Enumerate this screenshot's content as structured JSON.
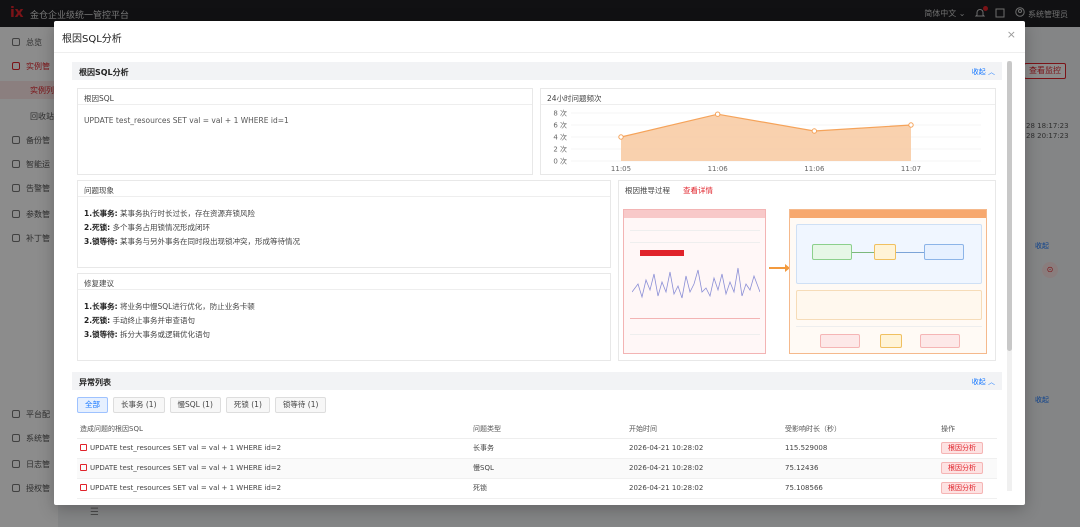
{
  "app": {
    "title": "金仓企业级统一管控平台",
    "language": "简体中文",
    "user": "系统管理员"
  },
  "sidebar": {
    "items": [
      {
        "label": "总览"
      },
      {
        "label": "实例管"
      },
      {
        "label": "实例列"
      },
      {
        "label": "回收站"
      },
      {
        "label": "备份管"
      },
      {
        "label": "智能运"
      },
      {
        "label": "告警管"
      },
      {
        "label": "参数管"
      },
      {
        "label": "补丁管"
      },
      {
        "label": "平台配"
      },
      {
        "label": "系统管"
      },
      {
        "label": "日志管"
      },
      {
        "label": "授权管"
      }
    ]
  },
  "background": {
    "view_monitor_button": "查看监控",
    "times": [
      "28 18:17:23",
      "28 20:17:23"
    ],
    "collapse_label": "收起",
    "circle_glyph": "⊙"
  },
  "modal": {
    "title": "根因SQL分析",
    "close_glyph": "×",
    "root_section": {
      "title": "根因SQL分析",
      "collapse": "收起 ︿",
      "root_sql_panel": {
        "title": "根因SQL",
        "sql": "UPDATE test_resources SET val = val + 1 WHERE id=1"
      },
      "frequency_panel": {
        "title": "24小时问题频次"
      },
      "phenomenon_panel": {
        "title": "问题现象",
        "lines": [
          {
            "key": "1.长事务:",
            "text": "某事务执行时长过长，存在资源弃锁风险"
          },
          {
            "key": "2.死锁:",
            "text": "多个事务占用锁情况形成闭环"
          },
          {
            "key": "3.锁等待:",
            "text": "某事务与另外事务在同时段出现锁冲突，形成等待情况"
          }
        ]
      },
      "fix_panel": {
        "title": "修复建议",
        "lines": [
          {
            "key": "1.长事务:",
            "text": "将业务中慢SQL进行优化，防止业务卡顿"
          },
          {
            "key": "2.死锁:",
            "text": "手动终止事务并审查语句"
          },
          {
            "key": "3.锁等待:",
            "text": "拆分大事务或逻辑优化语句"
          }
        ]
      },
      "derivation_panel": {
        "title": "根因推导过程",
        "link": "查看详情"
      }
    },
    "anomaly_section": {
      "title": "异常列表",
      "collapse": "收起 ︿",
      "tabs": [
        {
          "label": "全部",
          "active": true
        },
        {
          "label": "长事务 (1)",
          "active": false
        },
        {
          "label": "慢SQL (1)",
          "active": false
        },
        {
          "label": "死锁 (1)",
          "active": false
        },
        {
          "label": "锁等待 (1)",
          "active": false
        }
      ],
      "columns": [
        "造成问题的根因SQL",
        "问题类型",
        "开始时间",
        "受影响时长（秒）",
        "操作"
      ],
      "rows": [
        {
          "sql": "UPDATE test_resources SET val = val + 1 WHERE id=2",
          "type": "长事务",
          "start": "2026-04-21 10:28:02",
          "duration": "115.529008",
          "action": "根因分析"
        },
        {
          "sql": "UPDATE test_resources SET val = val + 1 WHERE id=2",
          "type": "慢SQL",
          "start": "2026-04-21 10:28:02",
          "duration": "75.12436",
          "action": "根因分析"
        },
        {
          "sql": "UPDATE test_resources SET val = val + 1 WHERE id=2",
          "type": "死锁",
          "start": "2026-04-21 10:28:02",
          "duration": "75.108566",
          "action": "根因分析"
        }
      ]
    }
  },
  "chart_data": {
    "type": "area",
    "title": "24小时问题频次",
    "categories": [
      "11:05",
      "11:06",
      "11:06",
      "11:07"
    ],
    "values": [
      4,
      7.8,
      5,
      6
    ],
    "ytick_labels": [
      "0 次",
      "2 次",
      "4 次",
      "6 次",
      "8 次"
    ],
    "ylim": [
      0,
      8
    ],
    "color": "#f5a35a",
    "fill": "#f8c9a0",
    "grid": true
  }
}
